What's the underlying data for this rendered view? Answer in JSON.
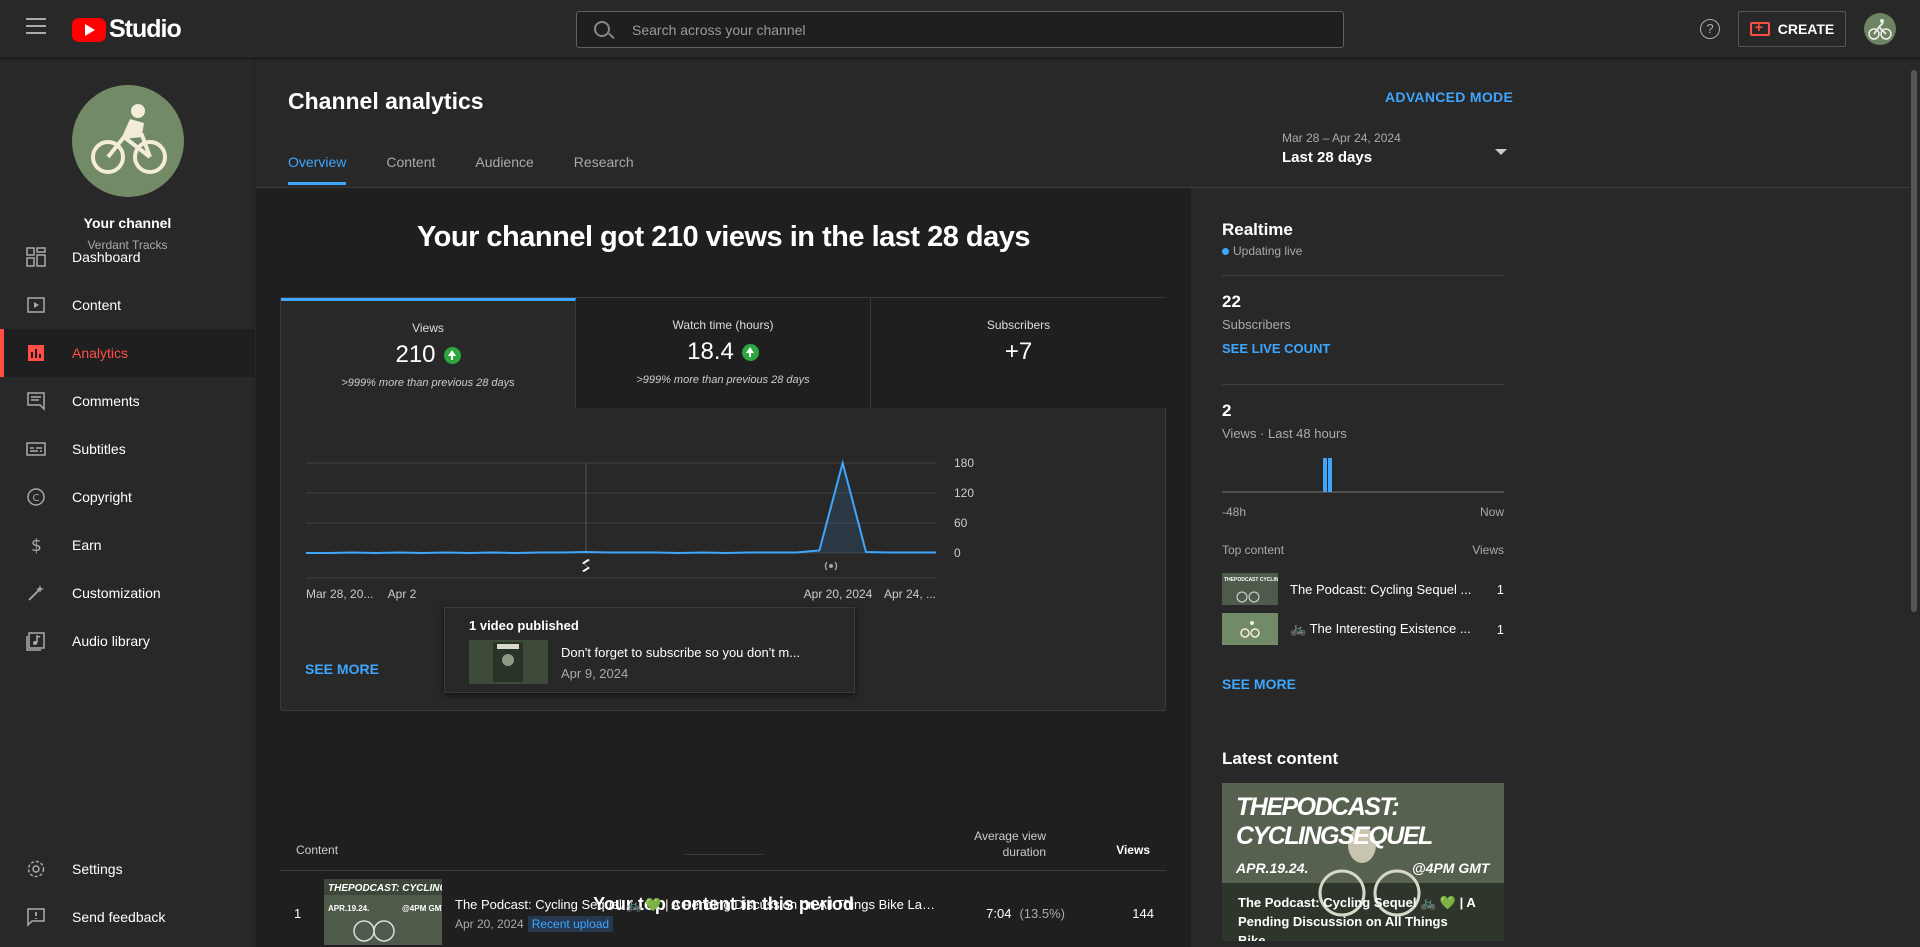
{
  "header": {
    "logo_text": "Studio",
    "search_placeholder": "Search across your channel",
    "help_label": "?",
    "create_label": "CREATE"
  },
  "sidebar": {
    "channel_name": "Your channel",
    "channel_handle": "Verdant Tracks",
    "items": [
      {
        "label": "Dashboard",
        "icon": "dashboard-icon"
      },
      {
        "label": "Content",
        "icon": "content-icon"
      },
      {
        "label": "Analytics",
        "icon": "analytics-icon",
        "active": true
      },
      {
        "label": "Comments",
        "icon": "comments-icon"
      },
      {
        "label": "Subtitles",
        "icon": "subtitles-icon"
      },
      {
        "label": "Copyright",
        "icon": "copyright-icon"
      },
      {
        "label": "Earn",
        "icon": "earn-icon"
      },
      {
        "label": "Customization",
        "icon": "customization-icon"
      },
      {
        "label": "Audio library",
        "icon": "audio-library-icon"
      }
    ],
    "bottom_items": [
      {
        "label": "Settings",
        "icon": "gear-icon"
      },
      {
        "label": "Send feedback",
        "icon": "feedback-icon"
      }
    ]
  },
  "page": {
    "title": "Channel analytics",
    "advanced_mode": "ADVANCED MODE",
    "tabs": [
      "Overview",
      "Content",
      "Audience",
      "Research"
    ],
    "active_tab": "Overview",
    "date_range": "Mar 28 – Apr 24, 2024",
    "date_preset": "Last 28 days"
  },
  "overview": {
    "headline": "Your channel got 210 views in the last 28 days",
    "metrics": [
      {
        "label": "Views",
        "value": "210",
        "trend": "up",
        "compare": ">999% more than previous 28 days"
      },
      {
        "label": "Watch time (hours)",
        "value": "18.4",
        "trend": "up",
        "compare": ">999% more than previous 28 days"
      },
      {
        "label": "Subscribers",
        "value": "+7",
        "trend": "",
        "compare": ""
      }
    ],
    "see_more": "SEE MORE",
    "tooltip": {
      "heading": "1 video published",
      "video_title": "Don't forget to subscribe so you don't m...",
      "video_date": "Apr 9, 2024"
    },
    "top_content_title": "Your top content in this period",
    "table": {
      "col_content": "Content",
      "col_avd": "Average view duration",
      "col_views": "Views",
      "rows": [
        {
          "rank": "1",
          "title": "The Podcast: Cycling Sequel 🚲 💚 | A Pending Discussion on All Things Bike Lan...",
          "date": "Apr 20, 2024",
          "badge": "Recent upload",
          "avd": "7:04",
          "avd_pct": "(13.5%)",
          "views": "144"
        }
      ]
    }
  },
  "chart_data": {
    "type": "line",
    "x": [
      "Mar 28",
      "Mar 29",
      "Mar 30",
      "Mar 31",
      "Apr 1",
      "Apr 2",
      "Apr 3",
      "Apr 4",
      "Apr 5",
      "Apr 6",
      "Apr 7",
      "Apr 8",
      "Apr 9",
      "Apr 10",
      "Apr 11",
      "Apr 12",
      "Apr 13",
      "Apr 14",
      "Apr 15",
      "Apr 16",
      "Apr 17",
      "Apr 18",
      "Apr 19",
      "Apr 20",
      "Apr 21",
      "Apr 22",
      "Apr 23",
      "Apr 24"
    ],
    "series": [
      {
        "values": [
          0,
          0,
          1,
          0,
          1,
          0,
          1,
          0,
          1,
          0,
          1,
          1,
          2,
          1,
          1,
          1,
          0,
          1,
          0,
          1,
          1,
          1,
          5,
          180,
          2,
          1,
          1,
          1
        ]
      }
    ],
    "ylim": [
      0,
      180
    ],
    "yticks": [
      "180",
      "120",
      "60",
      "0"
    ],
    "xtick_labels": [
      "Mar 28, 20...",
      "Apr 2",
      "Apr 20, 2024",
      "Apr 24, ..."
    ],
    "event_markers": [
      "shorts-icon",
      "live-icon"
    ],
    "color": "#3ea6ff"
  },
  "realtime": {
    "title": "Realtime",
    "status": "Updating live",
    "subscribers_value": "22",
    "subscribers_label": "Subscribers",
    "see_live_count": "SEE LIVE COUNT",
    "views_value": "2",
    "views_label": "Views · Last 48 hours",
    "axis_left": "-48h",
    "axis_right": "Now",
    "top_content_label": "Top content",
    "views_col": "Views",
    "items": [
      {
        "title": "The Podcast: Cycling Sequel ...",
        "views": "1"
      },
      {
        "title": "🚲 The Interesting Existence ...",
        "views": "1"
      }
    ],
    "see_more": "SEE MORE"
  },
  "latest": {
    "title": "Latest content",
    "thumb_text_top": "THEPODCAST: CYCLINGSEQUEL",
    "thumb_text_date": "APR.19.24.",
    "thumb_text_time": "@4PM GMT",
    "caption": "The Podcast: Cycling Sequel 🚲 💚 | A Pending Discussion on All Things Bike..."
  }
}
